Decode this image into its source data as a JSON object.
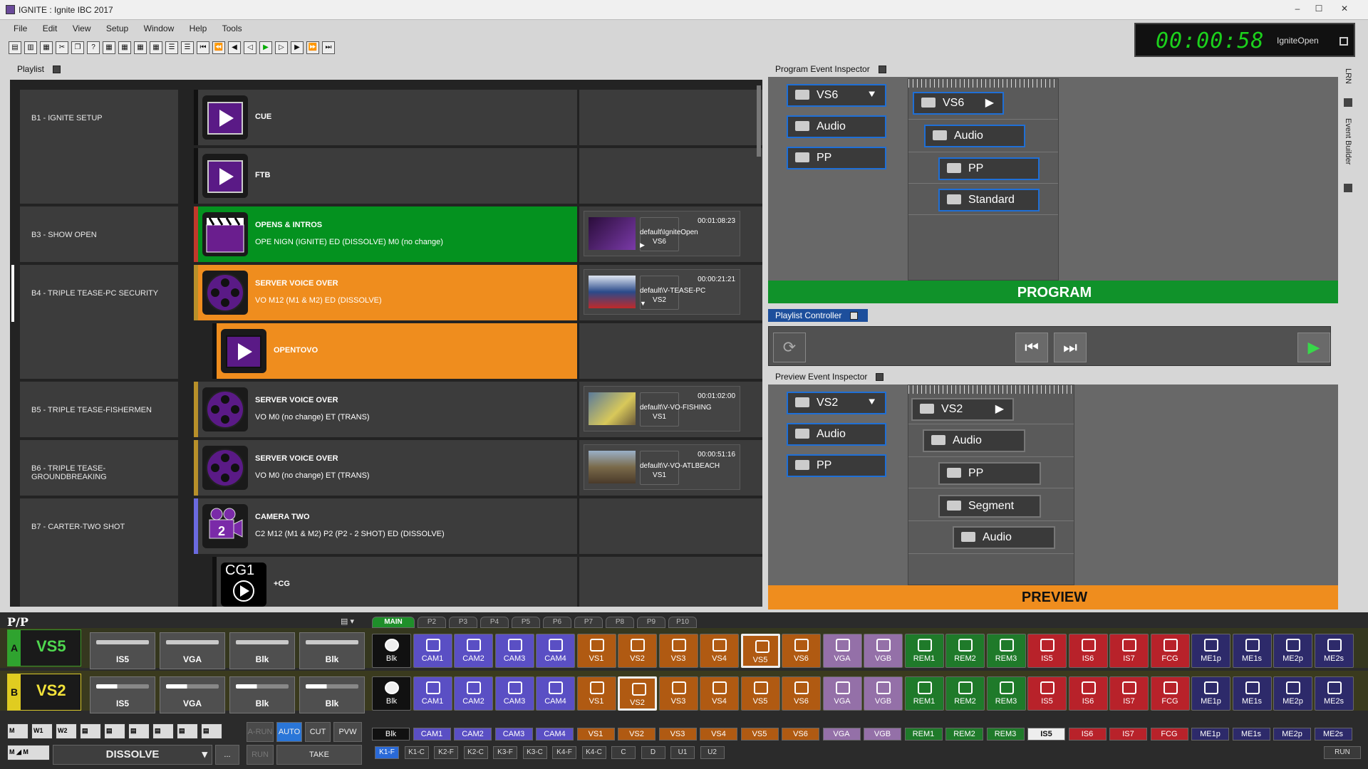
{
  "window": {
    "title": "IGNITE : Ignite IBC 2017",
    "min": "–",
    "max": "☐",
    "close": "✕"
  },
  "menu": [
    "File",
    "Edit",
    "View",
    "Setup",
    "Window",
    "Help",
    "Tools"
  ],
  "clock": {
    "time": "00:00:58",
    "name": "IgniteOpen"
  },
  "panes": {
    "playlist": "Playlist",
    "program_inspector": "Program Event Inspector",
    "playlist_controller": "Playlist Controller",
    "preview_inspector": "Preview Event Inspector"
  },
  "side_tabs": [
    "LRN",
    "Event Builder"
  ],
  "playlist": {
    "blocks": [
      {
        "name": "B1 - IGNITE SETUP"
      },
      {
        "name": "B3 - SHOW OPEN"
      },
      {
        "name": "B4 - TRIPLE TEASE-PC SECURITY"
      },
      {
        "name": "B5 - TRIPLE TEASE-FISHERMEN"
      },
      {
        "name": "B6 - TRIPLE TEASE-GROUNDBREAKING"
      },
      {
        "name": "B7 - CARTER-TWO SHOT"
      }
    ],
    "events": [
      {
        "name": "CUE",
        "desc": ""
      },
      {
        "name": "FTB",
        "desc": ""
      },
      {
        "name": "OPENS & INTROS",
        "desc": "OPE NIGN (IGNITE) ED (DISSOLVE) M0 (no change)",
        "source": "VS6",
        "timecode": "00:01:08:23",
        "path": "default\\IgniteOpen",
        "marker": "▶"
      },
      {
        "name": "SERVER VOICE OVER",
        "desc": "VO M12 (M1 & M2) ED (DISSOLVE)",
        "source": "VS2",
        "timecode": "00:00:21:21",
        "path": "default\\V-TEASE-PC",
        "marker": "▼"
      },
      {
        "name": "OPENTOVO",
        "desc": ""
      },
      {
        "name": "SERVER VOICE OVER",
        "desc": "VO M0 (no change) ET (TRANS)",
        "source": "VS1",
        "timecode": "00:01:02:00",
        "path": "default\\V-VO-FISHING",
        "marker": ""
      },
      {
        "name": "SERVER VOICE OVER",
        "desc": "VO M0 (no change) ET (TRANS)",
        "source": "VS1",
        "timecode": "00:00:51:16",
        "path": "default\\V-VO-ATLBEACH",
        "marker": ""
      },
      {
        "name": "CAMERA TWO",
        "desc": "C2 M12 (M1 & M2) P2 (P2 - 2 SHOT) ED (DISSOLVE)"
      },
      {
        "name": "+CG",
        "desc": "",
        "icon_text": "CG1"
      }
    ]
  },
  "program": {
    "left": [
      {
        "label": "VS6",
        "arrow": "⯆"
      },
      {
        "label": "Audio"
      },
      {
        "label": "PP"
      }
    ],
    "tree": [
      {
        "label": "VS6",
        "arrow": "▶"
      },
      {
        "label": "Audio"
      },
      {
        "label": "PP"
      },
      {
        "label": "Standard"
      }
    ],
    "banner": "PROGRAM"
  },
  "preview": {
    "left": [
      {
        "label": "VS2",
        "arrow": "⯆"
      },
      {
        "label": "Audio"
      },
      {
        "label": "PP"
      }
    ],
    "tree": [
      {
        "label": "VS2",
        "arrow": "▶"
      },
      {
        "label": "Audio"
      },
      {
        "label": "PP"
      },
      {
        "label": "Segment"
      },
      {
        "label": "Audio"
      }
    ],
    "banner": "PREVIEW"
  },
  "controller": {
    "refresh": "⟳",
    "prev": "⏮",
    "next": "⏭",
    "play": "▶"
  },
  "switcher": {
    "label": "P/P",
    "tabs": [
      "MAIN",
      "P2",
      "P3",
      "P4",
      "P5",
      "P6",
      "P7",
      "P8",
      "P9",
      "P10"
    ],
    "rowA": {
      "letter": "A",
      "source": "VS5",
      "faders": [
        "IS5",
        "VGA",
        "Blk",
        "Blk"
      ],
      "selected": "VS5"
    },
    "rowB": {
      "letter": "B",
      "source": "VS2",
      "faders": [
        "IS5",
        "VGA",
        "Blk",
        "Blk"
      ],
      "selected": "VS2"
    },
    "sources": [
      {
        "label": "Blk",
        "color": "#111111"
      },
      {
        "label": "CAM1",
        "color": "#5a4fc4"
      },
      {
        "label": "CAM2",
        "color": "#5a4fc4"
      },
      {
        "label": "CAM3",
        "color": "#5a4fc4"
      },
      {
        "label": "CAM4",
        "color": "#5a4fc4"
      },
      {
        "label": "VS1",
        "color": "#b05a12"
      },
      {
        "label": "VS2",
        "color": "#b05a12"
      },
      {
        "label": "VS3",
        "color": "#b05a12"
      },
      {
        "label": "VS4",
        "color": "#b05a12"
      },
      {
        "label": "VS5",
        "color": "#b05a12"
      },
      {
        "label": "VS6",
        "color": "#b05a12"
      },
      {
        "label": "VGA",
        "color": "#9470a8"
      },
      {
        "label": "VGB",
        "color": "#9470a8"
      },
      {
        "label": "REM1",
        "color": "#1f7a2a"
      },
      {
        "label": "REM2",
        "color": "#1f7a2a"
      },
      {
        "label": "REM3",
        "color": "#1f7a2a"
      },
      {
        "label": "IS5",
        "color": "#b8222a"
      },
      {
        "label": "IS6",
        "color": "#b8222a"
      },
      {
        "label": "IS7",
        "color": "#b8222a"
      },
      {
        "label": "FCG",
        "color": "#b8222a"
      },
      {
        "label": "ME1p",
        "color": "#2d2a6a"
      },
      {
        "label": "ME1s",
        "color": "#2d2a6a"
      },
      {
        "label": "ME2p",
        "color": "#2d2a6a"
      },
      {
        "label": "ME2s",
        "color": "#2d2a6a"
      }
    ],
    "busC_selected": "IS5",
    "transition_buttons": [
      "A-RUN",
      "AUTO",
      "CUT",
      "PVW"
    ],
    "transition": "DISSOLVE",
    "more": "...",
    "run": "RUN",
    "take": "TAKE",
    "keys": [
      "K1-F",
      "K1-C",
      "K2-F",
      "K2-C",
      "K3-F",
      "K3-C",
      "K4-F",
      "K4-C",
      "C",
      "D",
      "U1",
      "U2"
    ],
    "run_right": "RUN"
  }
}
